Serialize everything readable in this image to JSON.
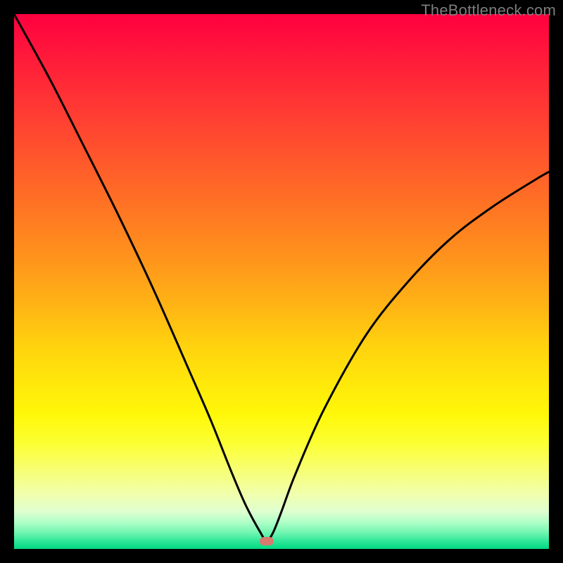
{
  "watermark": "TheBottleneck.com",
  "dot": {
    "x_frac": 0.472,
    "y_frac": 0.985,
    "color": "#d87a6e"
  },
  "chart_data": {
    "type": "line",
    "title": "",
    "xlabel": "",
    "ylabel": "",
    "xlim": [
      0,
      100
    ],
    "ylim": [
      0,
      100
    ],
    "grid": false,
    "series": [
      {
        "name": "bottleneck-curve",
        "x": [
          0,
          6.6,
          13.2,
          19.7,
          26.3,
          32.9,
          36.8,
          40.8,
          43.4,
          46.1,
          47.2,
          48.4,
          50.0,
          52.6,
          57.9,
          65.8,
          73.7,
          81.6,
          89.5,
          97.4,
          100.0
        ],
        "y": [
          100.0,
          88.0,
          75.0,
          62.0,
          48.0,
          33.0,
          24.0,
          14.0,
          8.0,
          3.0,
          1.5,
          3.0,
          7.0,
          14.0,
          26.0,
          40.0,
          50.0,
          58.0,
          64.0,
          69.0,
          70.5
        ]
      }
    ],
    "gradient_stops": [
      {
        "pos": 0,
        "color": "#ff0040"
      },
      {
        "pos": 50,
        "color": "#ffab17"
      },
      {
        "pos": 75,
        "color": "#fff80a"
      },
      {
        "pos": 100,
        "color": "#00d880"
      }
    ],
    "minimum_marker": {
      "x": 47.2,
      "y": 1.5,
      "color": "#d87a6e"
    }
  }
}
